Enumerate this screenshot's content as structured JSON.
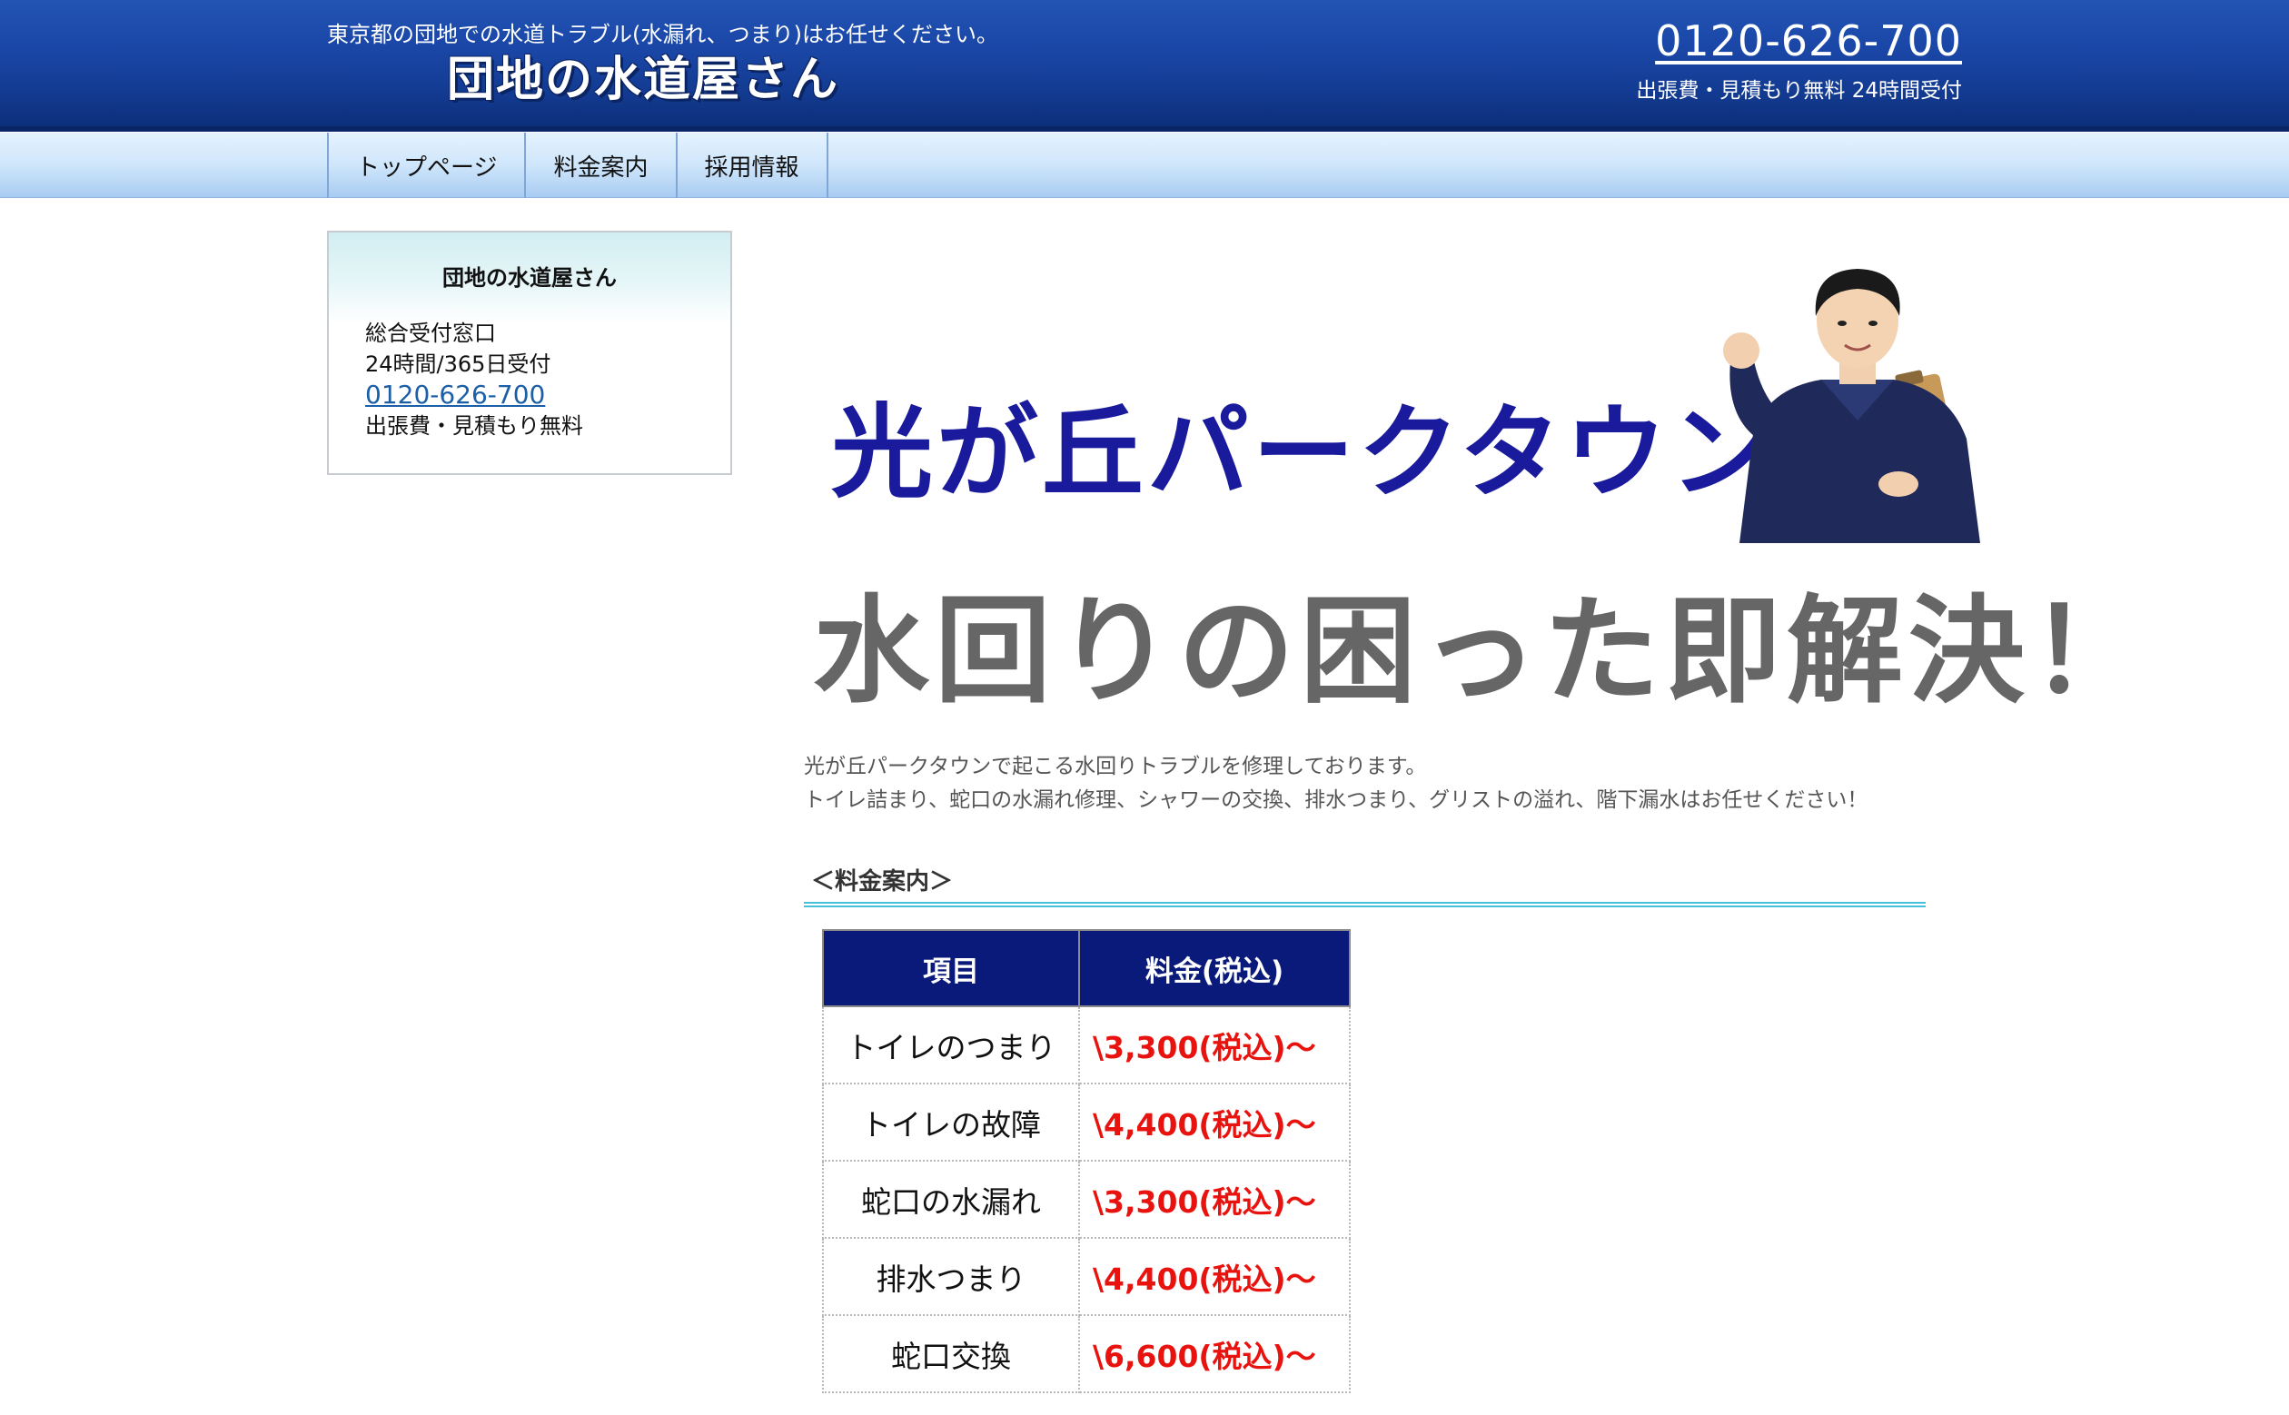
{
  "header": {
    "tagline": "東京都の団地での水道トラブル(水漏れ、つまり)はお任せください。",
    "logo": "団地の水道屋さん",
    "phone": "0120-626-700",
    "note": "出張費・見積もり無料 24時間受付"
  },
  "nav": {
    "items": [
      {
        "label": "トップページ"
      },
      {
        "label": "料金案内"
      },
      {
        "label": "採用情報"
      }
    ]
  },
  "sidebar": {
    "title": "団地の水道屋さん",
    "line1": "総合受付窓口",
    "line2": "24時間/365日受付",
    "phone": "0120-626-700",
    "line3": "出張費・見積もり無料"
  },
  "hero": {
    "title": "光が丘パークタウン",
    "subtitle": "水回りの困った即解決！"
  },
  "intro": {
    "line1": "光が丘パークタウンで起こる水回りトラブルを修理しております。",
    "line2": "トイレ詰まり、蛇口の水漏れ修理、シャワーの交換、排水つまり、グリストの溢れ、階下漏水はお任せください！"
  },
  "pricing": {
    "heading": "＜料金案内＞",
    "columns": [
      "項目",
      "料金(税込)"
    ],
    "rows": [
      {
        "item": "トイレのつまり",
        "price": "\\3,300(税込)〜"
      },
      {
        "item": "トイレの故障",
        "price": "\\4,400(税込)〜"
      },
      {
        "item": "蛇口の水漏れ",
        "price": "\\3,300(税込)〜"
      },
      {
        "item": "排水つまり",
        "price": "\\4,400(税込)〜"
      },
      {
        "item": "蛇口交換",
        "price": "\\6,600(税込)〜"
      }
    ]
  },
  "colors": {
    "header": "#1a46a6",
    "price": "#e8130e",
    "table_header": "#0a1a7a",
    "hero_title": "#1a1a9c"
  }
}
